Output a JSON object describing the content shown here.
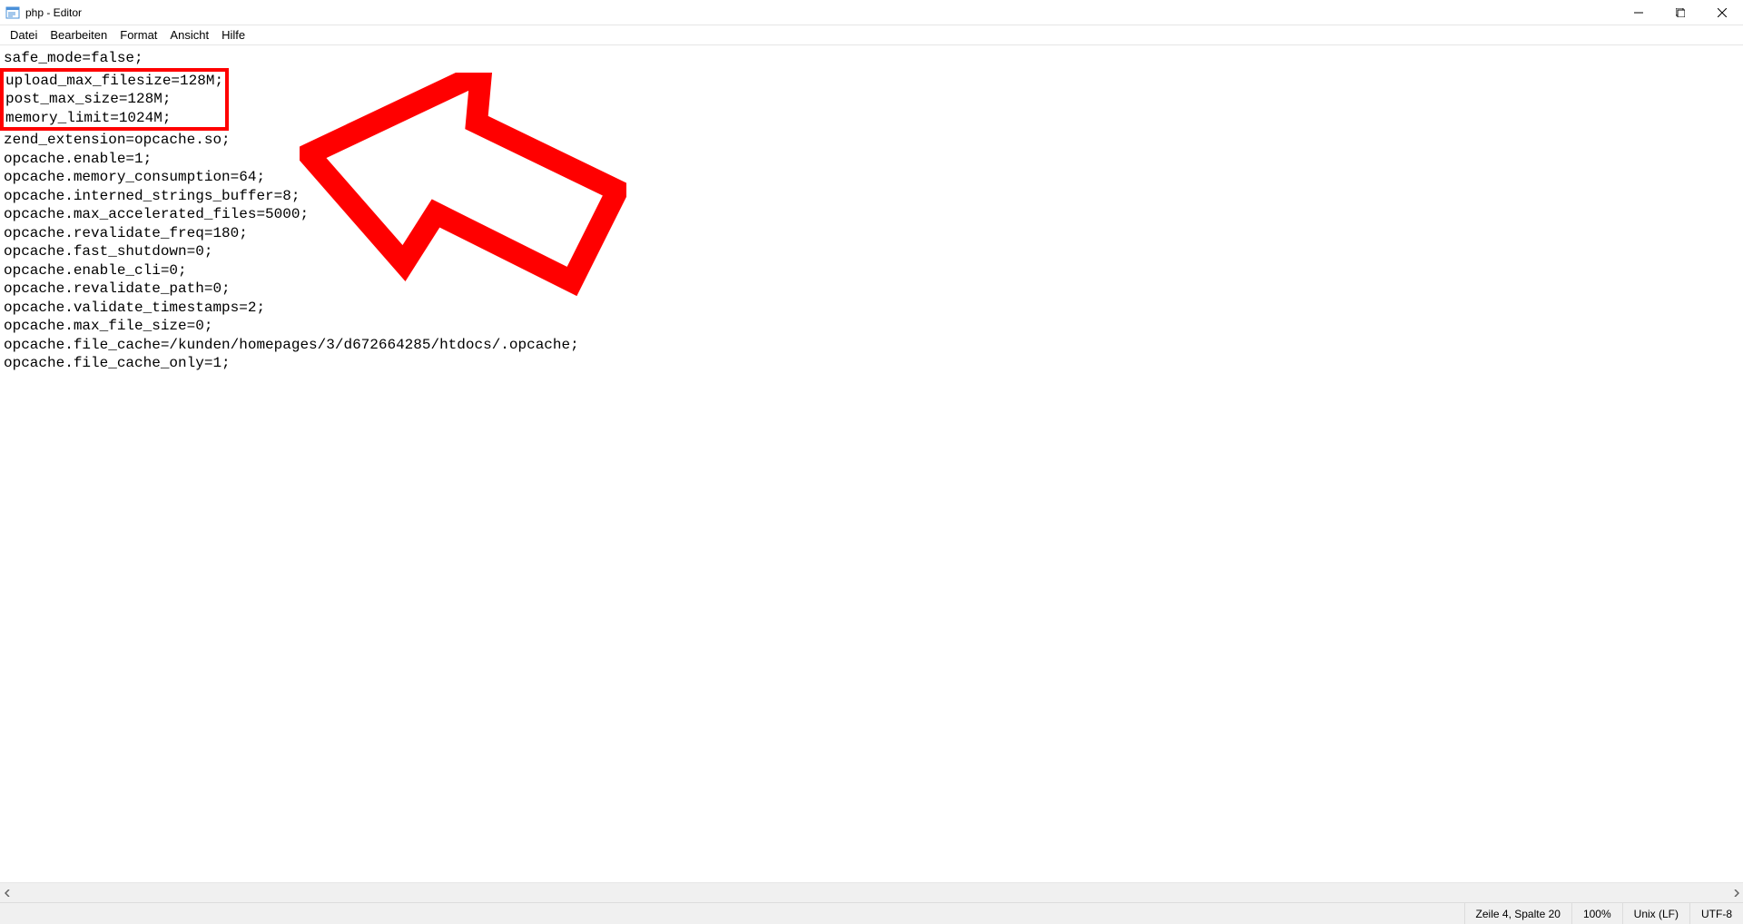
{
  "window": {
    "title": "php - Editor"
  },
  "menu": {
    "items": [
      "Datei",
      "Bearbeiten",
      "Format",
      "Ansicht",
      "Hilfe"
    ]
  },
  "editor": {
    "lines_before": "safe_mode=false;",
    "highlighted_lines": "upload_max_filesize=128M;\npost_max_size=128M;\nmemory_limit=1024M;",
    "lines_after": "zend_extension=opcache.so;\nopcache.enable=1;\nopcache.memory_consumption=64;\nopcache.interned_strings_buffer=8;\nopcache.max_accelerated_files=5000;\nopcache.revalidate_freq=180;\nopcache.fast_shutdown=0;\nopcache.enable_cli=0;\nopcache.revalidate_path=0;\nopcache.validate_timestamps=2;\nopcache.max_file_size=0;\nopcache.file_cache=/kunden/homepages/3/d672664285/htdocs/.opcache;\nopcache.file_cache_only=1;"
  },
  "status": {
    "position": "Zeile 4, Spalte 20",
    "zoom": "100%",
    "line_ending": "Unix (LF)",
    "encoding": "UTF-8"
  },
  "annotation": {
    "type": "arrow",
    "color": "#ff0000"
  }
}
